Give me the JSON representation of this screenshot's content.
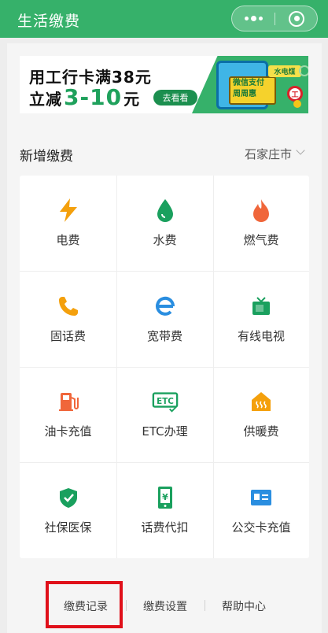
{
  "header": {
    "title": "生活缴费",
    "more_icon": "more-dots-icon",
    "close_icon": "mini-program-close-icon"
  },
  "banner": {
    "line1": "用工行卡满38元",
    "line2_prefix": "立减",
    "line2_range": "3-10",
    "line2_suffix": "元",
    "cta": "去看看",
    "tag": "水电煤",
    "board_line1": "微信支付",
    "board_line2": "周周惠",
    "bank_mark": "工"
  },
  "section": {
    "title": "新增缴费",
    "city": "石家庄市"
  },
  "services": [
    {
      "label": "电费",
      "icon": "lightning-icon",
      "color": "#f4a00c"
    },
    {
      "label": "水费",
      "icon": "water-drop-icon",
      "color": "#1aa05e"
    },
    {
      "label": "燃气费",
      "icon": "flame-icon",
      "color": "#f0663a"
    },
    {
      "label": "固话费",
      "icon": "phone-icon",
      "color": "#f4a00c"
    },
    {
      "label": "宽带费",
      "icon": "broadband-e-icon",
      "color": "#2a8ee0"
    },
    {
      "label": "有线电视",
      "icon": "tv-icon",
      "color": "#1aa05e"
    },
    {
      "label": "油卡充值",
      "icon": "fuel-pump-icon",
      "color": "#f0663a"
    },
    {
      "label": "ETC办理",
      "icon": "etc-icon",
      "color": "#1aa05e"
    },
    {
      "label": "供暖费",
      "icon": "heating-icon",
      "color": "#f4a00c"
    },
    {
      "label": "社保医保",
      "icon": "shield-check-icon",
      "color": "#1aa05e"
    },
    {
      "label": "话费代扣",
      "icon": "mobile-yuan-icon",
      "color": "#1aa05e"
    },
    {
      "label": "公交卡充值",
      "icon": "bus-card-icon",
      "color": "#2a8ee0"
    }
  ],
  "footer": {
    "records": "缴费记录",
    "settings": "缴费设置",
    "help": "帮助中心"
  }
}
